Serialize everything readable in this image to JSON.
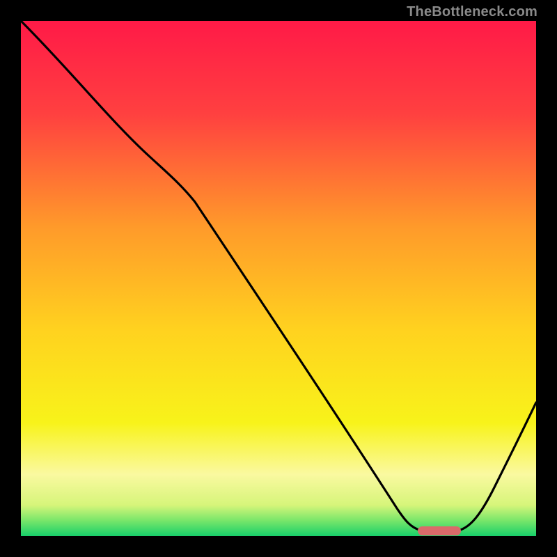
{
  "watermark": "TheBottleneck.com",
  "chart_data": {
    "type": "line",
    "title": "",
    "xlabel": "",
    "ylabel": "",
    "xlim": [
      0,
      100
    ],
    "ylim": [
      0,
      100
    ],
    "series": [
      {
        "name": "bottleneck-curve",
        "x": [
          0,
          10,
          20,
          25,
          30,
          40,
          50,
          60,
          70,
          74,
          78,
          82,
          85,
          90,
          95,
          100
        ],
        "values": [
          100,
          90,
          79,
          74,
          68,
          55,
          40,
          25,
          10,
          3,
          1,
          1,
          1,
          8,
          18,
          26
        ]
      }
    ],
    "marker": {
      "name": "optimal-range",
      "x_start": 77,
      "x_end": 85,
      "y": 1
    },
    "background": {
      "type": "vertical-gradient",
      "stops": [
        {
          "pct": 0,
          "color": "#ff1a47"
        },
        {
          "pct": 18,
          "color": "#ff4040"
        },
        {
          "pct": 40,
          "color": "#ff9a2a"
        },
        {
          "pct": 60,
          "color": "#ffd21f"
        },
        {
          "pct": 78,
          "color": "#f8f31a"
        },
        {
          "pct": 88,
          "color": "#faf9a0"
        },
        {
          "pct": 94,
          "color": "#d6f57a"
        },
        {
          "pct": 97,
          "color": "#78e66a"
        },
        {
          "pct": 100,
          "color": "#17d06a"
        }
      ]
    }
  }
}
